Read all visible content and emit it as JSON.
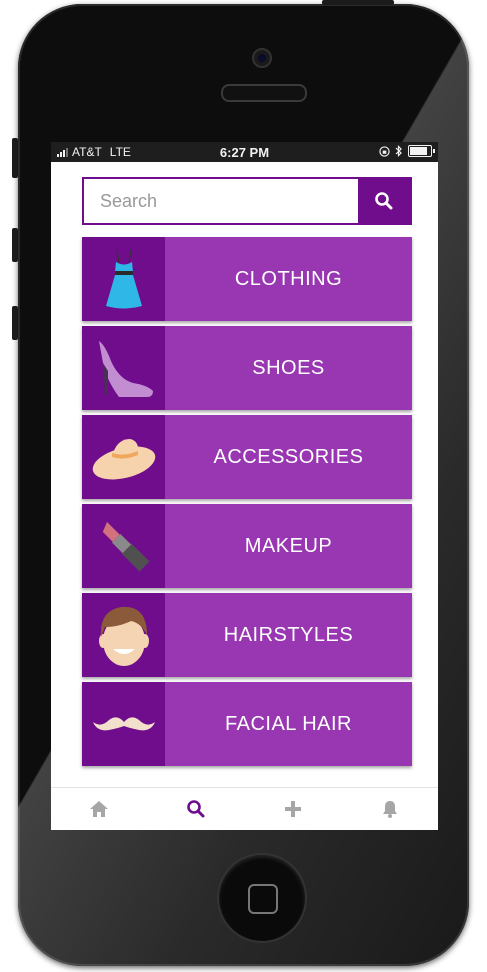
{
  "status_bar": {
    "carrier": "AT&T",
    "network": "LTE",
    "time": "6:27 PM"
  },
  "search": {
    "placeholder": "Search",
    "icon": "search-icon"
  },
  "categories": [
    {
      "label": "CLOTHING",
      "icon": "dress-icon"
    },
    {
      "label": "SHOES",
      "icon": "high-heel-icon"
    },
    {
      "label": "ACCESSORIES",
      "icon": "sun-hat-icon"
    },
    {
      "label": "MAKEUP",
      "icon": "lipstick-icon"
    },
    {
      "label": "HAIRSTYLES",
      "icon": "face-hair-icon"
    },
    {
      "label": "FACIAL HAIR",
      "icon": "mustache-icon"
    }
  ],
  "tab_bar": [
    {
      "name": "home",
      "icon": "home-icon",
      "active": false
    },
    {
      "name": "search",
      "icon": "search-icon",
      "active": true
    },
    {
      "name": "add",
      "icon": "plus-icon",
      "active": false
    },
    {
      "name": "notifications",
      "icon": "bell-icon",
      "active": false
    }
  ],
  "colors": {
    "primary_dark": "#6f0d8c",
    "primary": "#9837b1",
    "tab_inactive": "#a6a6a6",
    "tab_active": "#6f0d8c"
  }
}
